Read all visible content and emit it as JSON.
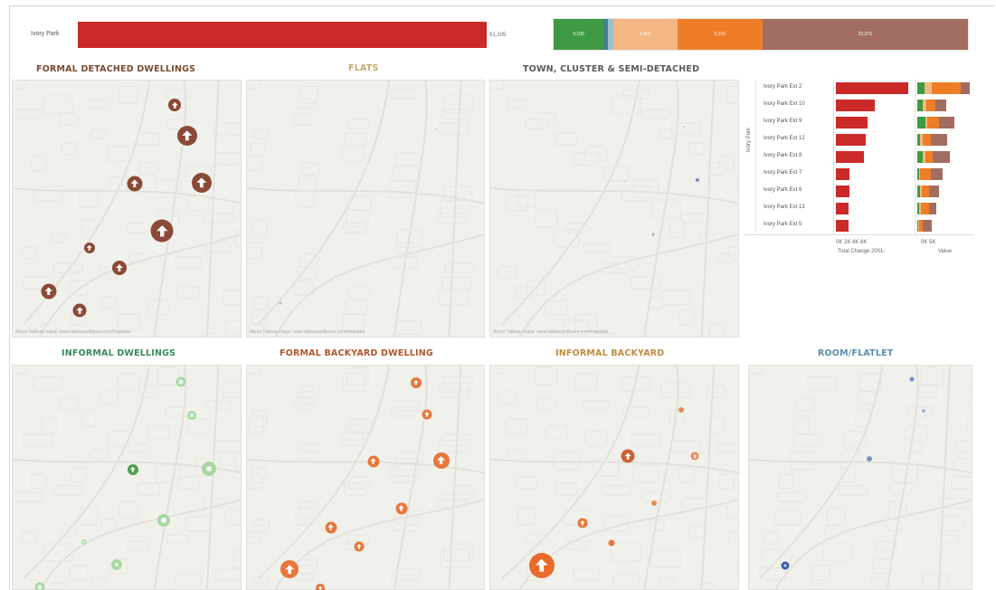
{
  "header": {
    "area_label": "Ivory Park",
    "total_value": "51,105",
    "stack": [
      {
        "label": "9,106",
        "color": "#3f9a44",
        "share": 0.12
      },
      {
        "label": "",
        "color": "#477c94",
        "share": 0.012
      },
      {
        "label": "",
        "color": "#9bc1c9",
        "share": 0.012
      },
      {
        "label": "6,965",
        "color": "#f4b683",
        "share": 0.155
      },
      {
        "label": "9,216",
        "color": "#ee7d27",
        "share": 0.205
      },
      {
        "label": "22,276",
        "color": "#a16d63",
        "share": 0.496
      }
    ]
  },
  "panels": {
    "formal_detached": {
      "title": "FORMAL DETACHED DWELLINGS",
      "color": "#7a4a32",
      "credit": "About Tableau maps: www.tableausoftware.com/mapdata"
    },
    "flats": {
      "title": "FLATS",
      "color": "#c2a86a",
      "credit": "About Tableau maps: www.tableausoftware.com/mapdata"
    },
    "town_cluster": {
      "title": "TOWN, CLUSTER & SEMI-DETACHED",
      "color": "#5a5a5a",
      "credit": "About Tableau maps: www.tableausoftware.com/mapdata"
    },
    "informal": {
      "title": "INFORMAL DWELLINGS",
      "color": "#3a8a59"
    },
    "formal_backyard": {
      "title": "FORMAL BACKYARD DWELLING",
      "color": "#b2552a"
    },
    "informal_backyard": {
      "title": "INFORMAL BACKYARD",
      "color": "#c18a3f"
    },
    "room_flatlet": {
      "title": "ROOM/FLATLET",
      "color": "#5b8eb0"
    }
  },
  "bar_panel": {
    "axis_title": "Ivory Park",
    "rows": [
      {
        "name": "Ivory Park Ext 2",
        "total": 7800,
        "segs": [
          0.9,
          1.0,
          2.4,
          1.3,
          1.2
        ]
      },
      {
        "name": "Ivory Park Ext 10",
        "total": 4200,
        "segs": [
          0.7,
          0.5,
          0.6,
          0.5,
          1.4
        ]
      },
      {
        "name": "Ivory Park Ext 9",
        "total": 3400,
        "segs": [
          1.0,
          0.3,
          0.5,
          1.0,
          2.0
        ]
      },
      {
        "name": "Ivory Park Ext 12",
        "total": 3200,
        "segs": [
          0.4,
          0.3,
          0.6,
          0.5,
          2.0
        ]
      },
      {
        "name": "Ivory Park Ext 8",
        "total": 3000,
        "segs": [
          0.7,
          0.3,
          0.5,
          0.5,
          2.2
        ]
      },
      {
        "name": "Ivory Park Ext 7",
        "total": 1500,
        "segs": [
          0.2,
          0.2,
          0.7,
          0.6,
          1.6
        ]
      },
      {
        "name": "Ivory Park Ext 6",
        "total": 1500,
        "segs": [
          0.3,
          0.3,
          0.4,
          0.5,
          1.3
        ]
      },
      {
        "name": "Ivory Park Ext 13",
        "total": 1400,
        "segs": [
          0.2,
          0.3,
          0.5,
          0.5,
          1.0
        ]
      },
      {
        "name": "Ivory Park Ext 5",
        "total": 1400,
        "segs": [
          0.1,
          0.1,
          0.2,
          0.3,
          1.2
        ]
      }
    ],
    "seg_colors": [
      "#3f9a44",
      "#f4b683",
      "#ee7d27",
      "#ee7d27",
      "#a16d63"
    ],
    "ticks1": "0K  2K    4K   6K",
    "ticks2": "0K          5K",
    "xlabel1": "Total Change 2001-",
    "xlabel2": "Value"
  }
}
